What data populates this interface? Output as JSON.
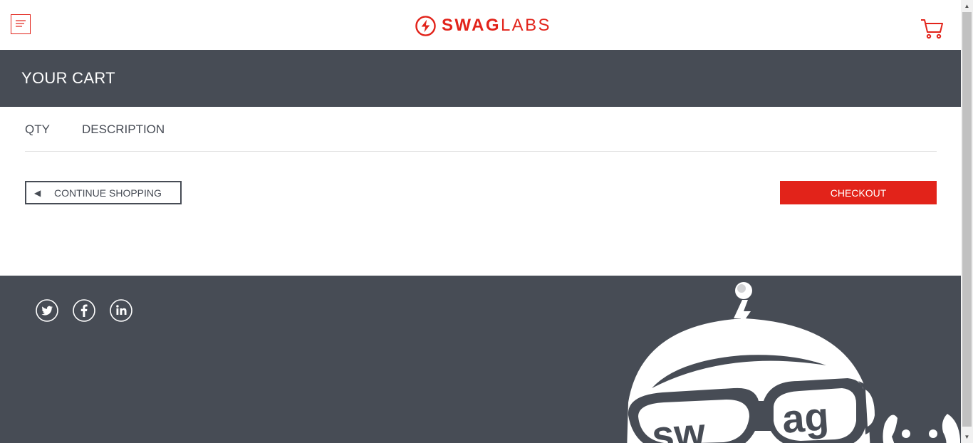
{
  "header": {
    "logo_bold": "SWAG",
    "logo_light": "LABS"
  },
  "page": {
    "title": "YOUR CART"
  },
  "cart": {
    "qty_label": "QTY",
    "description_label": "DESCRIPTION",
    "continue_arrow": "◀",
    "continue_label": "CONTINUE SHOPPING",
    "checkout_label": "CHECKOUT"
  },
  "footer": {
    "social": [
      "twitter-icon",
      "facebook-icon",
      "linkedin-icon"
    ],
    "mascot_text_left": "sw",
    "mascot_text_right": "ag"
  },
  "scrollbar": {
    "up": "▲",
    "down": "▼"
  },
  "colors": {
    "brand": "#e2231a",
    "dark": "#474c55",
    "white": "#ffffff"
  },
  "icons": {
    "menu": "hamburger-menu-icon",
    "cart": "shopping-cart-icon",
    "logo": "swag-bolt-logo-icon"
  }
}
